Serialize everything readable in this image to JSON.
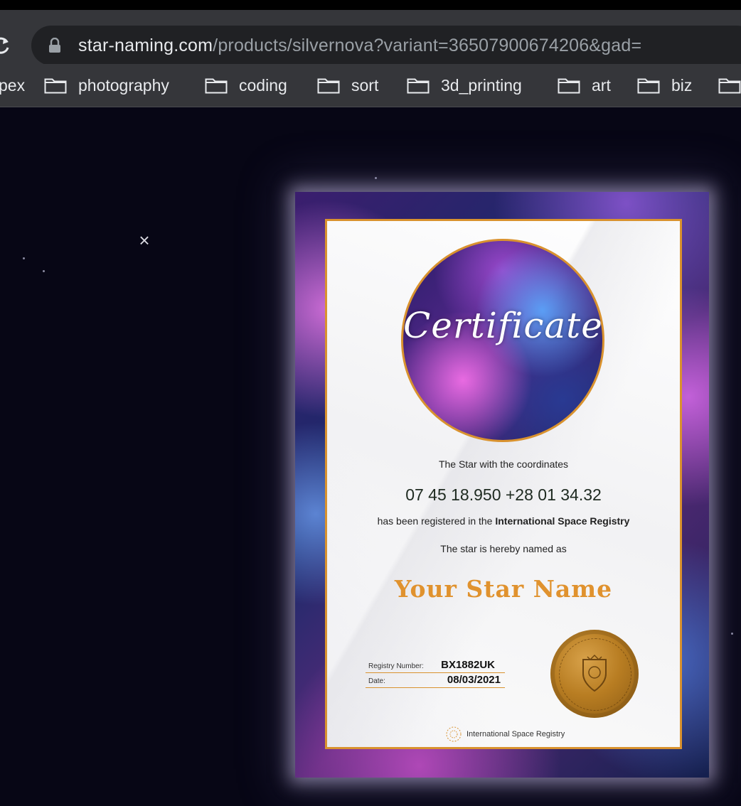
{
  "browser": {
    "url_host": "star-naming.com",
    "url_path": "/products/silvernova?variant=36507900674206&gad=",
    "bookmarks": [
      {
        "label": "pex"
      },
      {
        "label": "photography"
      },
      {
        "label": "coding"
      },
      {
        "label": "sort"
      },
      {
        "label": "3d_printing"
      },
      {
        "label": "art"
      },
      {
        "label": "biz"
      }
    ]
  },
  "lightbox": {
    "close_label": "×"
  },
  "certificate": {
    "title": "Certificate",
    "intro": "The Star with the coordinates",
    "coordinates": "07 45 18.950 +28 01 34.32",
    "registered_prefix": "has been registered in the ",
    "registry_name": "International Space Registry",
    "named_as": "The star is hereby named as",
    "star_name": "Your Star Name",
    "registry_number_label": "Registry Number:",
    "registry_number_value": "BX1882UK",
    "date_label": "Date:",
    "date_value": "08/03/2021",
    "footer": "International Space Registry"
  },
  "colors": {
    "accent": "#d9922e",
    "page_background": "#070615",
    "browser_chrome": "#35363a"
  }
}
